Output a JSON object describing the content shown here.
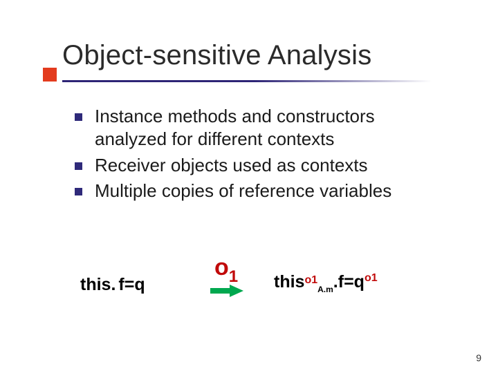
{
  "title": "Object-sensitive Analysis",
  "bullets": [
    "Instance methods and constructors analyzed for different contexts",
    "Receiver objects used as contexts",
    "Multiple copies of reference variables"
  ],
  "formula": {
    "lhs_this": "this.",
    "lhs_rest": "f=q",
    "context_o": "o",
    "context_1": "1",
    "rhs_this": "this",
    "rhs_sub_am": "A.m",
    "rhs_dot": ".",
    "rhs_f_eq": "f=q",
    "rhs_o1_a": "o1",
    "rhs_o1_b": "o1"
  },
  "page_number": "9"
}
